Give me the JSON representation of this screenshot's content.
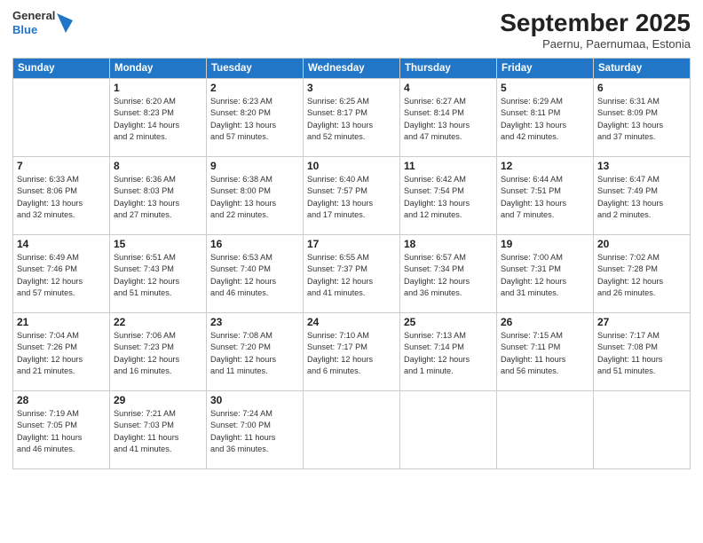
{
  "header": {
    "logo_general": "General",
    "logo_blue": "Blue",
    "title": "September 2025",
    "subtitle": "Paernu, Paernumaa, Estonia"
  },
  "weekdays": [
    "Sunday",
    "Monday",
    "Tuesday",
    "Wednesday",
    "Thursday",
    "Friday",
    "Saturday"
  ],
  "weeks": [
    [
      {
        "day": "",
        "info": ""
      },
      {
        "day": "1",
        "info": "Sunrise: 6:20 AM\nSunset: 8:23 PM\nDaylight: 14 hours\nand 2 minutes."
      },
      {
        "day": "2",
        "info": "Sunrise: 6:23 AM\nSunset: 8:20 PM\nDaylight: 13 hours\nand 57 minutes."
      },
      {
        "day": "3",
        "info": "Sunrise: 6:25 AM\nSunset: 8:17 PM\nDaylight: 13 hours\nand 52 minutes."
      },
      {
        "day": "4",
        "info": "Sunrise: 6:27 AM\nSunset: 8:14 PM\nDaylight: 13 hours\nand 47 minutes."
      },
      {
        "day": "5",
        "info": "Sunrise: 6:29 AM\nSunset: 8:11 PM\nDaylight: 13 hours\nand 42 minutes."
      },
      {
        "day": "6",
        "info": "Sunrise: 6:31 AM\nSunset: 8:09 PM\nDaylight: 13 hours\nand 37 minutes."
      }
    ],
    [
      {
        "day": "7",
        "info": "Sunrise: 6:33 AM\nSunset: 8:06 PM\nDaylight: 13 hours\nand 32 minutes."
      },
      {
        "day": "8",
        "info": "Sunrise: 6:36 AM\nSunset: 8:03 PM\nDaylight: 13 hours\nand 27 minutes."
      },
      {
        "day": "9",
        "info": "Sunrise: 6:38 AM\nSunset: 8:00 PM\nDaylight: 13 hours\nand 22 minutes."
      },
      {
        "day": "10",
        "info": "Sunrise: 6:40 AM\nSunset: 7:57 PM\nDaylight: 13 hours\nand 17 minutes."
      },
      {
        "day": "11",
        "info": "Sunrise: 6:42 AM\nSunset: 7:54 PM\nDaylight: 13 hours\nand 12 minutes."
      },
      {
        "day": "12",
        "info": "Sunrise: 6:44 AM\nSunset: 7:51 PM\nDaylight: 13 hours\nand 7 minutes."
      },
      {
        "day": "13",
        "info": "Sunrise: 6:47 AM\nSunset: 7:49 PM\nDaylight: 13 hours\nand 2 minutes."
      }
    ],
    [
      {
        "day": "14",
        "info": "Sunrise: 6:49 AM\nSunset: 7:46 PM\nDaylight: 12 hours\nand 57 minutes."
      },
      {
        "day": "15",
        "info": "Sunrise: 6:51 AM\nSunset: 7:43 PM\nDaylight: 12 hours\nand 51 minutes."
      },
      {
        "day": "16",
        "info": "Sunrise: 6:53 AM\nSunset: 7:40 PM\nDaylight: 12 hours\nand 46 minutes."
      },
      {
        "day": "17",
        "info": "Sunrise: 6:55 AM\nSunset: 7:37 PM\nDaylight: 12 hours\nand 41 minutes."
      },
      {
        "day": "18",
        "info": "Sunrise: 6:57 AM\nSunset: 7:34 PM\nDaylight: 12 hours\nand 36 minutes."
      },
      {
        "day": "19",
        "info": "Sunrise: 7:00 AM\nSunset: 7:31 PM\nDaylight: 12 hours\nand 31 minutes."
      },
      {
        "day": "20",
        "info": "Sunrise: 7:02 AM\nSunset: 7:28 PM\nDaylight: 12 hours\nand 26 minutes."
      }
    ],
    [
      {
        "day": "21",
        "info": "Sunrise: 7:04 AM\nSunset: 7:26 PM\nDaylight: 12 hours\nand 21 minutes."
      },
      {
        "day": "22",
        "info": "Sunrise: 7:06 AM\nSunset: 7:23 PM\nDaylight: 12 hours\nand 16 minutes."
      },
      {
        "day": "23",
        "info": "Sunrise: 7:08 AM\nSunset: 7:20 PM\nDaylight: 12 hours\nand 11 minutes."
      },
      {
        "day": "24",
        "info": "Sunrise: 7:10 AM\nSunset: 7:17 PM\nDaylight: 12 hours\nand 6 minutes."
      },
      {
        "day": "25",
        "info": "Sunrise: 7:13 AM\nSunset: 7:14 PM\nDaylight: 12 hours\nand 1 minute."
      },
      {
        "day": "26",
        "info": "Sunrise: 7:15 AM\nSunset: 7:11 PM\nDaylight: 11 hours\nand 56 minutes."
      },
      {
        "day": "27",
        "info": "Sunrise: 7:17 AM\nSunset: 7:08 PM\nDaylight: 11 hours\nand 51 minutes."
      }
    ],
    [
      {
        "day": "28",
        "info": "Sunrise: 7:19 AM\nSunset: 7:05 PM\nDaylight: 11 hours\nand 46 minutes."
      },
      {
        "day": "29",
        "info": "Sunrise: 7:21 AM\nSunset: 7:03 PM\nDaylight: 11 hours\nand 41 minutes."
      },
      {
        "day": "30",
        "info": "Sunrise: 7:24 AM\nSunset: 7:00 PM\nDaylight: 11 hours\nand 36 minutes."
      },
      {
        "day": "",
        "info": ""
      },
      {
        "day": "",
        "info": ""
      },
      {
        "day": "",
        "info": ""
      },
      {
        "day": "",
        "info": ""
      }
    ]
  ]
}
